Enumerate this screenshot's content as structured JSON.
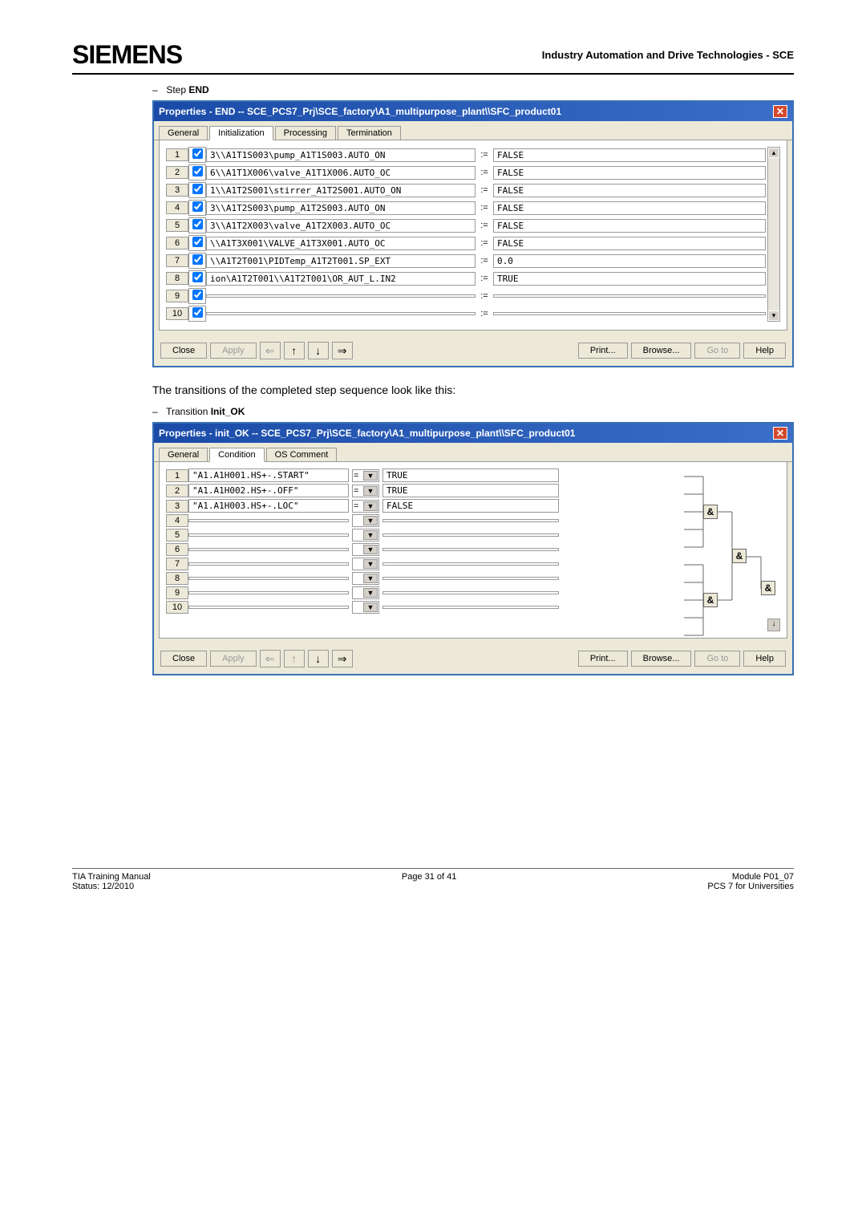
{
  "header": {
    "logo": "SIEMENS",
    "right": "Industry Automation and Drive Technologies - SCE"
  },
  "section1": {
    "bullet": "–",
    "label_pre": "Step ",
    "label_bold": "END"
  },
  "dialog1": {
    "title": "Properties - END -- SCE_PCS7_Prj\\SCE_factory\\A1_multipurpose_plant\\\\SFC_product01",
    "tabs": [
      "General",
      "Initialization",
      "Processing",
      "Termination"
    ],
    "active_tab_idx": 1,
    "rows": [
      {
        "n": "1",
        "checked": true,
        "lhs": "3\\\\A1T1S003\\pump_A1T1S003.AUTO_ON",
        "rhs": "FALSE"
      },
      {
        "n": "2",
        "checked": true,
        "lhs": "6\\\\A1T1X006\\valve_A1T1X006.AUTO_OC",
        "rhs": "FALSE"
      },
      {
        "n": "3",
        "checked": true,
        "lhs": "1\\\\A1T2S001\\stirrer_A1T2S001.AUTO_ON",
        "rhs": "FALSE"
      },
      {
        "n": "4",
        "checked": true,
        "lhs": "3\\\\A1T2S003\\pump_A1T2S003.AUTO_ON",
        "rhs": "FALSE"
      },
      {
        "n": "5",
        "checked": true,
        "lhs": "3\\\\A1T2X003\\valve_A1T2X003.AUTO_OC",
        "rhs": "FALSE"
      },
      {
        "n": "6",
        "checked": true,
        "lhs": "\\\\A1T3X001\\VALVE_A1T3X001.AUTO_OC",
        "rhs": "FALSE"
      },
      {
        "n": "7",
        "checked": true,
        "lhs": "\\\\A1T2T001\\PIDTemp_A1T2T001.SP_EXT",
        "rhs": "0.0"
      },
      {
        "n": "8",
        "checked": true,
        "lhs": "ion\\A1T2T001\\\\A1T2T001\\OR_AUT_L.IN2",
        "rhs": "TRUE"
      },
      {
        "n": "9",
        "checked": true,
        "lhs": "",
        "rhs": ""
      },
      {
        "n": "10",
        "checked": true,
        "lhs": "",
        "rhs": ""
      }
    ],
    "op": ":="
  },
  "mid_text": "The transitions of the completed step sequence look like this:",
  "section2": {
    "bullet": "–",
    "label_pre": "Transition ",
    "label_bold": "Init_OK"
  },
  "dialog2": {
    "title": "Properties - init_OK -- SCE_PCS7_Prj\\SCE_factory\\A1_multipurpose_plant\\\\SFC_product01",
    "tabs": [
      "General",
      "Condition",
      "OS Comment"
    ],
    "active_tab_idx": 1,
    "rows": [
      {
        "n": "1",
        "lhs": "\"A1.A1H001.HS+-.START\"",
        "op": "=",
        "rhs": "TRUE"
      },
      {
        "n": "2",
        "lhs": "\"A1.A1H002.HS+-.OFF\"",
        "op": "=",
        "rhs": "TRUE"
      },
      {
        "n": "3",
        "lhs": "\"A1.A1H003.HS+-.LOC\"",
        "op": "=",
        "rhs": "FALSE"
      },
      {
        "n": "4",
        "lhs": "",
        "op": "",
        "rhs": ""
      },
      {
        "n": "5",
        "lhs": "",
        "op": "",
        "rhs": ""
      },
      {
        "n": "6",
        "lhs": "",
        "op": "",
        "rhs": ""
      },
      {
        "n": "7",
        "lhs": "",
        "op": "",
        "rhs": ""
      },
      {
        "n": "8",
        "lhs": "",
        "op": "",
        "rhs": ""
      },
      {
        "n": "9",
        "lhs": "",
        "op": "",
        "rhs": ""
      },
      {
        "n": "10",
        "lhs": "",
        "op": "",
        "rhs": ""
      }
    ],
    "logic_label": "&"
  },
  "btns": {
    "close": "Close",
    "apply": "Apply",
    "print": "Print...",
    "browse": "Browse...",
    "goto": "Go to",
    "help": "Help"
  },
  "footer": {
    "left1": "TIA Training Manual",
    "left2": "Status: 12/2010",
    "mid": "Page 31 of 41",
    "right1": "Module P01_07",
    "right2": "PCS 7 for Universities"
  }
}
